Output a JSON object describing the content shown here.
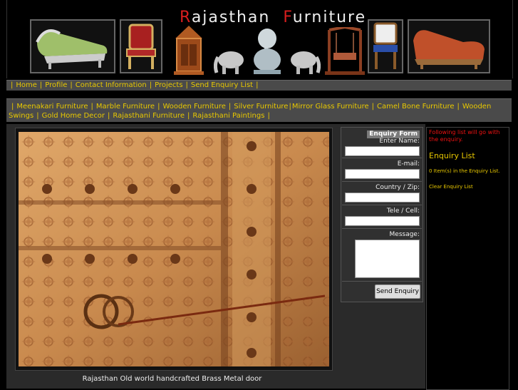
{
  "header": {
    "title_cap1": "R",
    "title_rest1": "ajasthan",
    "title_cap2": "F",
    "title_rest2": "urniture"
  },
  "nav": {
    "items": [
      "Home",
      "Profile",
      "Contact Information",
      "Projects",
      "Send Enquiry List"
    ]
  },
  "categories": {
    "items": [
      "Meenakari Furniture",
      "Marble Furniture",
      "Wooden Furniture",
      "Silver Furniture",
      "Mirror Glass Furniture",
      "Camel Bone Furniture",
      "Wooden Swings",
      "Gold Home Decor",
      "Rajasthani Furniture",
      "Rajasthani Paintings"
    ]
  },
  "main": {
    "caption": "Rajasthan Old world handcrafted Brass Metal door"
  },
  "form": {
    "heading": "Enquiry Form",
    "name_label": "Enter Name:",
    "email_label": "E-mail:",
    "country_label": "Country / Zip:",
    "phone_label": "Tele / Cell:",
    "message_label": "Message:",
    "send_label": "Send Enquiry"
  },
  "enquiry": {
    "note": "Following list will go with the enquiry.",
    "title": "Enquiry List",
    "count_text": "0 Item(s) in the Enquiry List.",
    "clear_label": "Clear Enquiry List"
  },
  "colors": {
    "accent_yellow": "#e8c800",
    "title_red": "#d81e1e",
    "bar_gray": "#4a4a4a"
  }
}
